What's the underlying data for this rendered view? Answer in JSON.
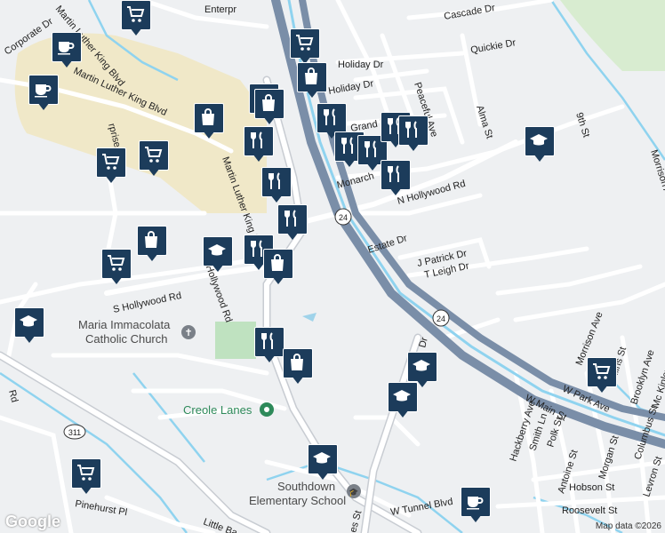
{
  "map": {
    "attribution": "Map data ©2026",
    "logo": "Google",
    "highway_shield": "24",
    "route_311": "311",
    "places": {
      "maria_church": "Maria Immacolata\nCatholic Church",
      "creole_lanes": "Creole Lanes",
      "southdown_school": "Southdown\nElementary School"
    },
    "streets": [
      "Cascade Dr",
      "Quickie Dr",
      "Enterpr",
      "Corporate Dr",
      "Martin Luther King Blvd",
      "Peaceful Ave",
      "Alma St",
      "9th St",
      "N Hollywood Rd",
      "Monarch",
      "Estate Dr",
      "J Patrick Dr",
      "T Leigh Dr",
      "S Hollywood Rd",
      "S Hollywood Rd",
      "W Park Ave",
      "W Main St",
      "Morrison Ave",
      "Morrison Ave",
      "Hackberry Ave",
      "Smith Ln",
      "Polk St",
      "Antoine St",
      "Morgan St",
      "Columbus St",
      "Levron St",
      "Brooklyn Ave",
      "Mc Kinley St",
      "Hobson St",
      "Roosevelt St",
      "W Tunnel Blvd",
      "Pinehurst Pl",
      "Little Ba",
      "Rd",
      "Holiday Dr",
      "Grand Dr",
      "rprise Dr",
      "Collins St",
      "es St",
      "Dr"
    ]
  },
  "markers": [
    {
      "icon": "cart-icon",
      "kind": "grocery"
    },
    {
      "icon": "coffee-icon",
      "kind": "cafe"
    },
    {
      "icon": "cart-icon",
      "kind": "grocery"
    },
    {
      "icon": "coffee-icon",
      "kind": "cafe"
    },
    {
      "icon": "bag-icon",
      "kind": "shopping"
    },
    {
      "icon": "bag-icon",
      "kind": "shopping"
    },
    {
      "icon": "bag-icon",
      "kind": "shopping"
    },
    {
      "icon": "cart-icon",
      "kind": "grocery"
    },
    {
      "icon": "cart-icon",
      "kind": "grocery"
    },
    {
      "icon": "bag-icon",
      "kind": "shopping"
    },
    {
      "icon": "fork-knife-icon",
      "kind": "restaurant"
    },
    {
      "icon": "fork-knife-icon",
      "kind": "restaurant"
    },
    {
      "icon": "fork-knife-icon",
      "kind": "restaurant"
    },
    {
      "icon": "fork-knife-icon",
      "kind": "restaurant"
    },
    {
      "icon": "fork-knife-icon",
      "kind": "restaurant"
    },
    {
      "icon": "fork-knife-icon",
      "kind": "restaurant"
    },
    {
      "icon": "fork-knife-icon",
      "kind": "restaurant"
    },
    {
      "icon": "fork-knife-icon",
      "kind": "restaurant"
    },
    {
      "icon": "fork-knife-icon",
      "kind": "restaurant"
    },
    {
      "icon": "graduation-cap-icon",
      "kind": "school"
    },
    {
      "icon": "bag-icon",
      "kind": "shopping"
    },
    {
      "icon": "cart-icon",
      "kind": "grocery"
    },
    {
      "icon": "graduation-cap-icon",
      "kind": "school"
    },
    {
      "icon": "fork-knife-icon",
      "kind": "restaurant"
    },
    {
      "icon": "bag-icon",
      "kind": "shopping"
    },
    {
      "icon": "graduation-cap-icon",
      "kind": "school"
    },
    {
      "icon": "fork-knife-icon",
      "kind": "restaurant"
    },
    {
      "icon": "bag-icon",
      "kind": "shopping"
    },
    {
      "icon": "graduation-cap-icon",
      "kind": "school"
    },
    {
      "icon": "graduation-cap-icon",
      "kind": "school"
    },
    {
      "icon": "cart-icon",
      "kind": "grocery"
    },
    {
      "icon": "graduation-cap-icon",
      "kind": "school"
    },
    {
      "icon": "cart-icon",
      "kind": "grocery"
    },
    {
      "icon": "coffee-icon",
      "kind": "cafe"
    }
  ]
}
